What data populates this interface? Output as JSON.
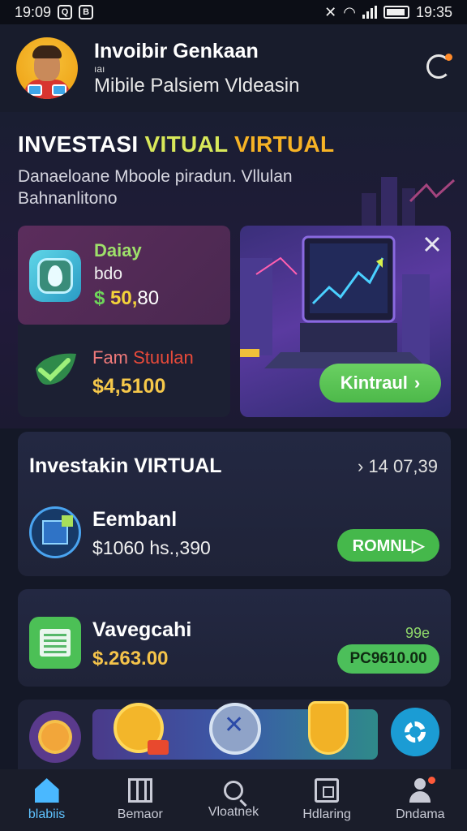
{
  "status_bar": {
    "time_left": "19:09",
    "time_right": "19:35",
    "icon_left_1": "Q",
    "icon_left_2": "B"
  },
  "header": {
    "title": "Invoibir Genkaan",
    "small_line": "ıaı",
    "subtitle": "Mibile Palsiem Vldeasin"
  },
  "hero": {
    "title_part1": "INVESTASI ",
    "title_part2": "VITUAL ",
    "title_part3": "VIRTUAL",
    "description_line1": "Danaeloane Mboole piradun. Vllulan",
    "description_line2": "Bahnanlitono"
  },
  "balance_card": {
    "label": "Daiay",
    "sub": "bdo",
    "currency": "$",
    "amount": "50,",
    "decimals": "80"
  },
  "fam_card": {
    "label_a": "Fam",
    "label_b": "Stuulan",
    "amount": "$4,5100"
  },
  "promo": {
    "button_label": "Kintraul",
    "button_chevron": "›"
  },
  "investment": {
    "title": "Investakin VIRTUAL",
    "date_chevron": "›",
    "date": "14 07,39",
    "item1": {
      "label": "Eembanl",
      "value": "$1060 hs.,390",
      "button": "ROMNL▷"
    },
    "item2": {
      "label": "Vavegcahi",
      "value": "$.263.00",
      "tag": "99e",
      "button": "PC9610.00"
    }
  },
  "bottom_nav": [
    {
      "label": "blabiis",
      "icon": "home-icon",
      "active": true
    },
    {
      "label": "Bemaor",
      "icon": "grid-icon",
      "active": false
    },
    {
      "label": "Vloatnek",
      "icon": "search-icon",
      "active": false
    },
    {
      "label": "Hdlaring",
      "icon": "box-icon",
      "active": false
    },
    {
      "label": "Dndama",
      "icon": "user-icon",
      "active": false
    }
  ],
  "colors": {
    "background": "#141827",
    "accent_green": "#4db94a",
    "accent_gold": "#f3d23a",
    "accent_blue": "#5fc3ff"
  }
}
